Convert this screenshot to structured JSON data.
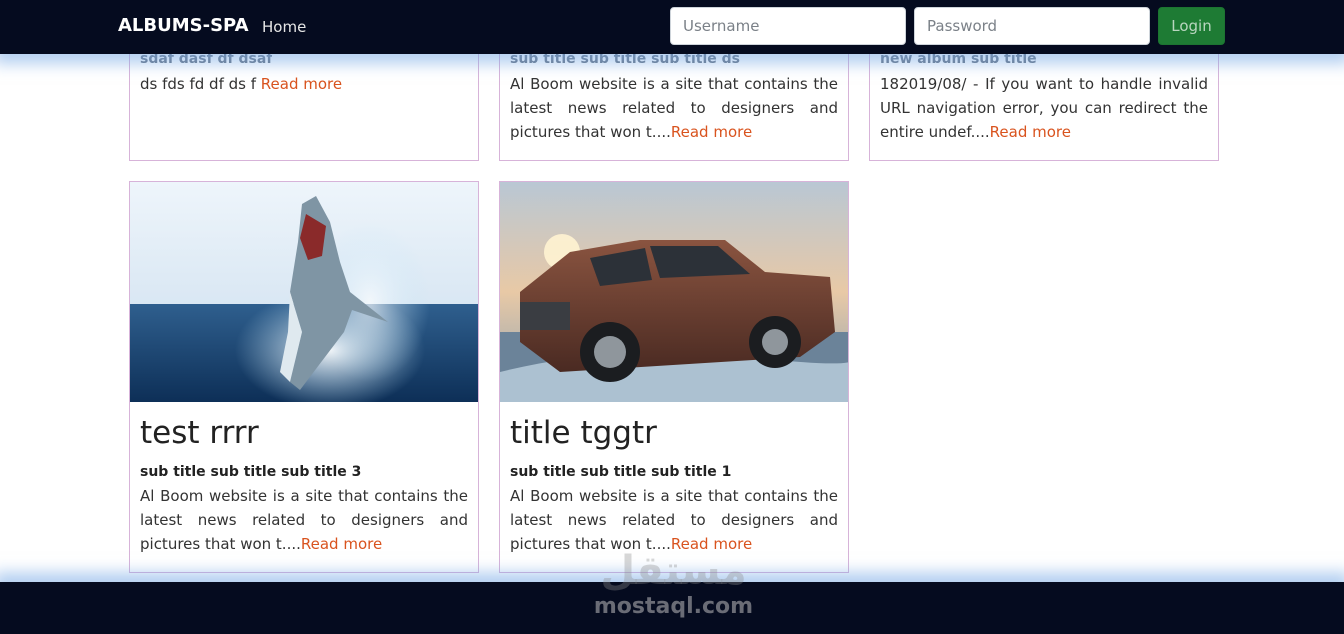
{
  "navbar": {
    "brand": "ALBUMS-SPA",
    "home_label": "Home",
    "username_placeholder": "Username",
    "password_placeholder": "Password",
    "login_label": "Login"
  },
  "cards": [
    {
      "title": "",
      "subtitle": "sdaf dasf df dsaf",
      "text": "ds fds fd df ds f ",
      "read_more": "Read more"
    },
    {
      "title": "",
      "subtitle": "sub title sub title sub title ds",
      "text": "Al Boom website is a site that contains the latest news related to designers and pictures that won t....",
      "read_more": "Read more"
    },
    {
      "title": "",
      "subtitle": "new album sub title",
      "text": "182019/08/ - If you want to handle invalid URL navigation error, you can redirect the entire undef....",
      "read_more": "Read more"
    },
    {
      "title": "test rrrr",
      "subtitle": "sub title sub title sub title 3",
      "text": "Al Boom website is a site that contains the latest news related to designers and pictures that won t....",
      "read_more": "Read more",
      "image": "shark-photo"
    },
    {
      "title": "title tggtr",
      "subtitle": "sub title sub title sub title 1",
      "text": "Al Boom website is a site that contains the latest news related to designers and pictures that won t....",
      "read_more": "Read more",
      "image": "pickup-truck-photo"
    }
  ],
  "watermark": {
    "arabic": "مستقل",
    "latin": "mostaql.com"
  },
  "colors": {
    "navbar_bg": "#050b1f",
    "login_button": "#1e7b34",
    "read_more": "#d9531e",
    "card_border": "#d7b3d9"
  }
}
